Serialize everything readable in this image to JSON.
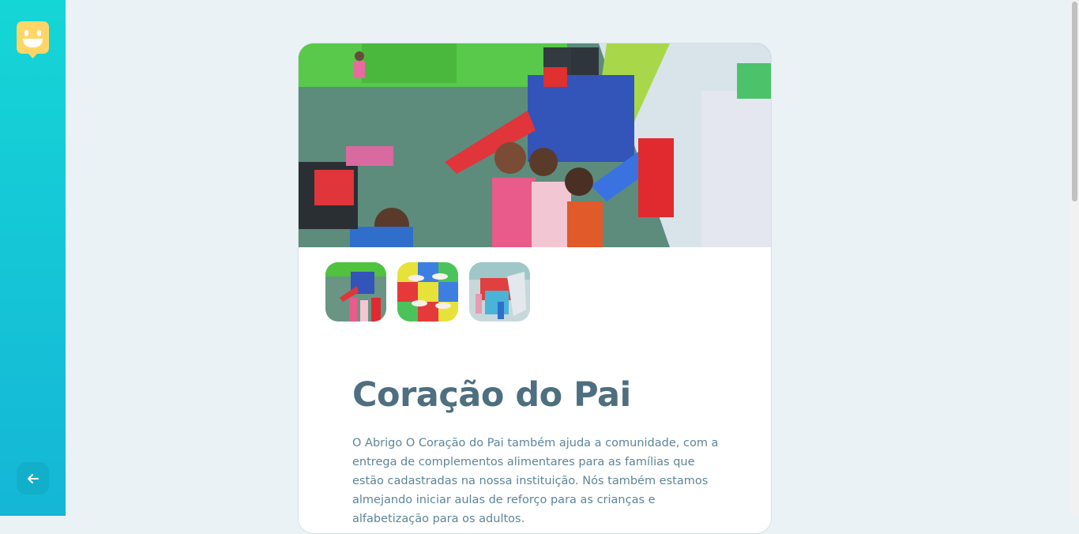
{
  "sidebar": {
    "logo_icon": "smiley-face-speech-balloon-icon",
    "back_icon": "arrow-left-icon",
    "logo_color": "#ffd666"
  },
  "orphanage": {
    "name": "Coração do Pai",
    "description": "O Abrigo O Coração do Pai também ajuda a comunidade, com a entrega de complementos alimentares para as famílias que estão cadastradas na nossa instituição. Nós também estamos almejando iniciar aulas de reforço para as crianças e alfabetização para os adultos.",
    "images": [
      "playground photo 1",
      "play mat photo 2",
      "playground photo 3"
    ]
  },
  "colors": {
    "sidebar_start": "#15d6d6",
    "sidebar_end": "#15b6d6",
    "title": "#4d6f80",
    "text": "#5c8599",
    "background": "#ebf2f5"
  }
}
